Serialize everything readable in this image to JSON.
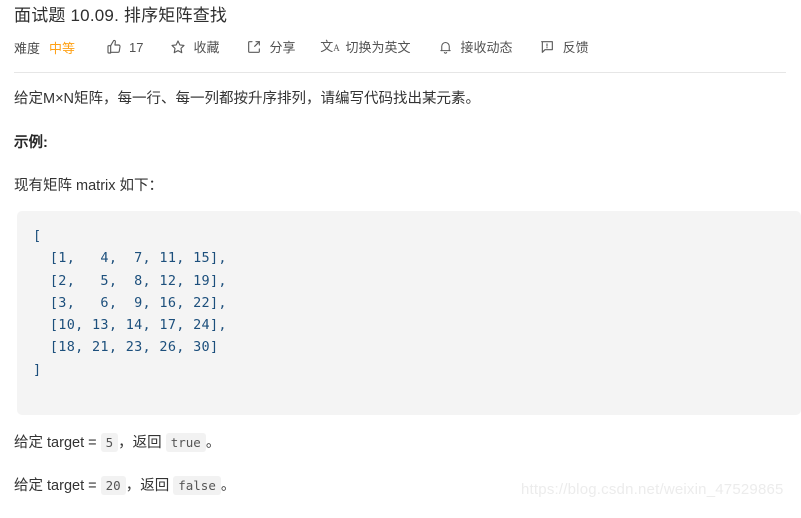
{
  "problem": {
    "title": "面试题 10.09. 排序矩阵查找"
  },
  "toolbar": {
    "difficulty_label": "难度",
    "difficulty_value": "中等",
    "difficulty_color": "#ffa116",
    "likes": "17",
    "favorite_label": "收藏",
    "share_label": "分享",
    "translate_label": "切换为英文",
    "subscribe_label": "接收动态",
    "feedback_label": "反馈"
  },
  "description": {
    "statement": "给定M×N矩阵，每一行、每一列都按升序排列，请编写代码找出某元素。",
    "example_heading": "示例:",
    "matrix_intro": "现有矩阵 matrix 如下："
  },
  "chart_data": {
    "type": "table",
    "title": "matrix",
    "rows": [
      [
        1,
        4,
        7,
        11,
        15
      ],
      [
        2,
        5,
        8,
        12,
        19
      ],
      [
        3,
        6,
        9,
        16,
        22
      ],
      [
        10,
        13,
        14,
        17,
        24
      ],
      [
        18,
        21,
        23,
        26,
        30
      ]
    ],
    "text": "[\n  [1,   4,  7, 11, 15],\n  [2,   5,  8, 12, 19],\n  [3,   6,  9, 16, 22],\n  [10, 13, 14, 17, 24],\n  [18, 21, 23, 26, 30]\n]"
  },
  "cases": [
    {
      "prefix": "给定 target = ",
      "target": "5",
      "middle": "，返回 ",
      "result": "true",
      "suffix": "。"
    },
    {
      "prefix": "给定 target = ",
      "target": "20",
      "middle": "，返回 ",
      "result": "false",
      "suffix": "。"
    }
  ],
  "watermark": "https://blog.csdn.net/weixin_47529865"
}
